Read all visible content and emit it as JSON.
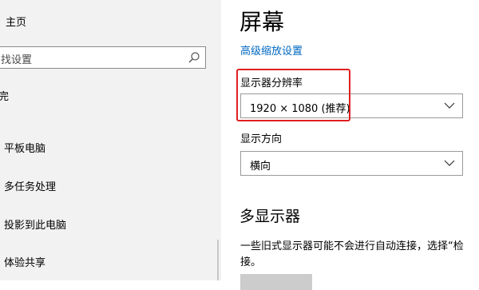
{
  "sidebar": {
    "home_label": "主页",
    "search_placeholder": "找设置",
    "system_fragment": "完",
    "items": [
      {
        "label": "平板电脑"
      },
      {
        "label": "多任务处理"
      },
      {
        "label": "投影到此电脑"
      },
      {
        "label": "体验共享"
      }
    ]
  },
  "main": {
    "title": "屏幕",
    "advanced_scaling_link": "高级缩放设置",
    "resolution": {
      "label": "显示器分辨率",
      "value": "1920 × 1080 (推荐)"
    },
    "orientation": {
      "label": "显示方向",
      "value": "横向"
    },
    "multi_display": {
      "title": "多显示器",
      "line1": "一些旧式显示器可能不会进行自动连接，选择“检",
      "line2": "接。"
    }
  },
  "colors": {
    "accent_link": "#0067c0",
    "highlight_box": "#e02020",
    "sidebar_bg": "#f2f2f2"
  },
  "icons": [
    "search-icon",
    "chevron-down-icon"
  ]
}
